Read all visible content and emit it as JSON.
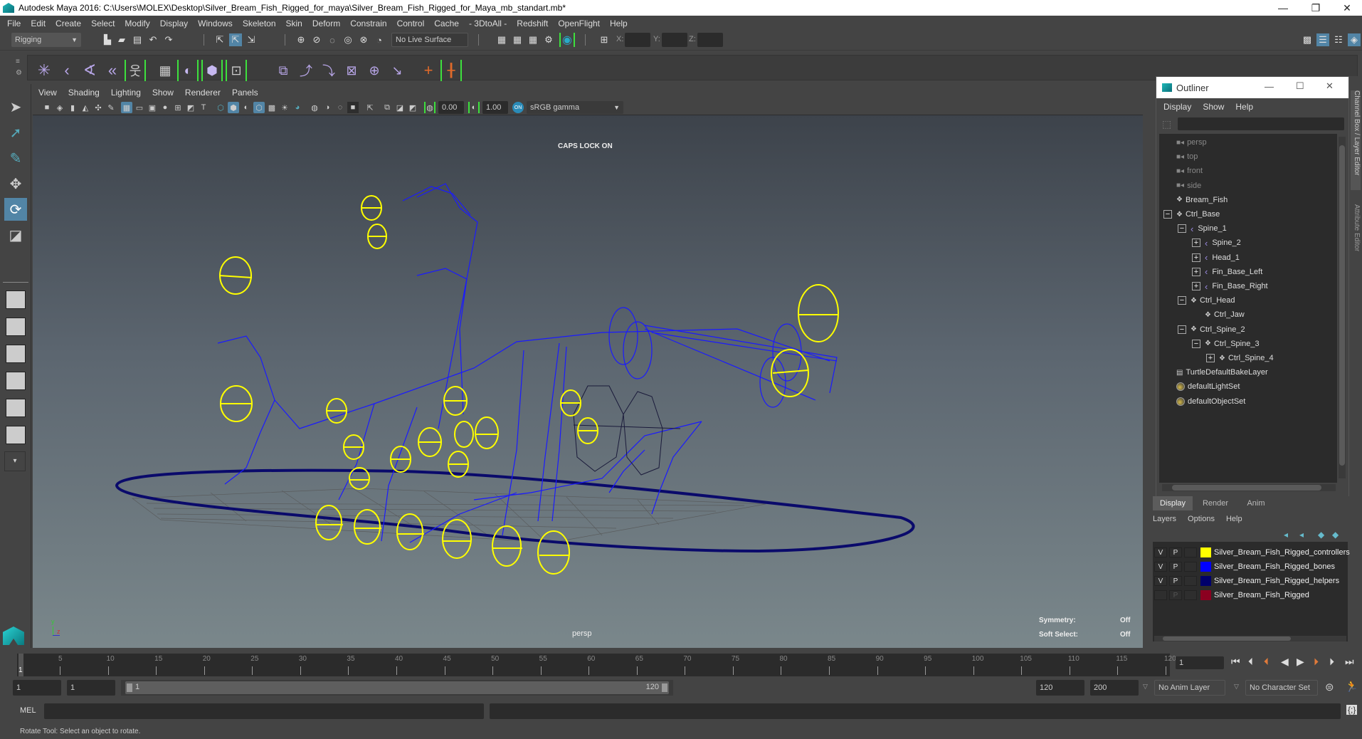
{
  "window": {
    "title": "Autodesk Maya 2016: C:\\Users\\MOLEX\\Desktop\\Silver_Bream_Fish_Rigged_for_maya\\Silver_Bream_Fish_Rigged_for_Maya_mb_standart.mb*",
    "minimize": "—",
    "restore": "❐",
    "close": "✕"
  },
  "menubar": [
    "File",
    "Edit",
    "Create",
    "Select",
    "Modify",
    "Display",
    "Windows",
    "Skeleton",
    "Skin",
    "Deform",
    "Constrain",
    "Control",
    "Cache",
    "- 3DtoAll -",
    "Redshift",
    "OpenFlight",
    "Help"
  ],
  "statusline": {
    "menuset": "Rigging",
    "live_surface": "No Live Surface",
    "x_label": "X:",
    "y_label": "Y:",
    "z_label": "Z:"
  },
  "viewport": {
    "menu": [
      "View",
      "Shading",
      "Lighting",
      "Show",
      "Renderer",
      "Panels"
    ],
    "exposure": "0.00",
    "gamma": "1.00",
    "color_space": "sRGB gamma",
    "caps_lock": "CAPS LOCK ON",
    "camera": "persp",
    "symmetry_label": "Symmetry:",
    "symmetry_value": "Off",
    "soft_select_label": "Soft Select:",
    "soft_select_value": "Off",
    "axis_y": "y",
    "axis_z": "z"
  },
  "outliner": {
    "title": "Outliner",
    "menu": [
      "Display",
      "Show",
      "Help"
    ],
    "items": [
      {
        "label": "persp",
        "type": "camera",
        "depth": 0,
        "expand": "",
        "dim": true
      },
      {
        "label": "top",
        "type": "camera",
        "depth": 0,
        "expand": "",
        "dim": true
      },
      {
        "label": "front",
        "type": "camera",
        "depth": 0,
        "expand": "",
        "dim": true
      },
      {
        "label": "side",
        "type": "camera",
        "depth": 0,
        "expand": "",
        "dim": true
      },
      {
        "label": "Bream_Fish",
        "type": "ctrl",
        "depth": 0,
        "expand": ""
      },
      {
        "label": "Ctrl_Base",
        "type": "ctrl",
        "depth": 0,
        "expand": "−"
      },
      {
        "label": "Spine_1",
        "type": "joint",
        "depth": 1,
        "expand": "−"
      },
      {
        "label": "Spine_2",
        "type": "joint",
        "depth": 2,
        "expand": "+"
      },
      {
        "label": "Head_1",
        "type": "joint",
        "depth": 2,
        "expand": "+"
      },
      {
        "label": "Fin_Base_Left",
        "type": "joint",
        "depth": 2,
        "expand": "+"
      },
      {
        "label": "Fin_Base_Right",
        "type": "joint",
        "depth": 2,
        "expand": "+"
      },
      {
        "label": "Ctrl_Head",
        "type": "ctrl",
        "depth": 1,
        "expand": "−"
      },
      {
        "label": "Ctrl_Jaw",
        "type": "ctrl",
        "depth": 2,
        "expand": ""
      },
      {
        "label": "Ctrl_Spine_2",
        "type": "ctrl",
        "depth": 1,
        "expand": "−"
      },
      {
        "label": "Ctrl_Spine_3",
        "type": "ctrl",
        "depth": 2,
        "expand": "−"
      },
      {
        "label": "Ctrl_Spine_4",
        "type": "ctrl",
        "depth": 3,
        "expand": "+"
      },
      {
        "label": "TurtleDefaultBakeLayer",
        "type": "layer",
        "depth": 0,
        "expand": ""
      },
      {
        "label": "defaultLightSet",
        "type": "set",
        "depth": 0,
        "expand": ""
      },
      {
        "label": "defaultObjectSet",
        "type": "set",
        "depth": 0,
        "expand": ""
      }
    ]
  },
  "right_tabs": [
    "Channel Box / Layer Editor",
    "Attribute Editor"
  ],
  "layer_editor": {
    "tabs": [
      "Display",
      "Render",
      "Anim"
    ],
    "active_tab": "Display",
    "menu": [
      "Layers",
      "Options",
      "Help"
    ],
    "layers": [
      {
        "v": "V",
        "p": "P",
        "name": "Silver_Bream_Fish_Rigged_controllers",
        "color": "#ffff00"
      },
      {
        "v": "V",
        "p": "P",
        "name": "Silver_Bream_Fish_Rigged_bones",
        "color": "#0000ff"
      },
      {
        "v": "V",
        "p": "P",
        "name": "Silver_Bream_Fish_Rigged_helpers",
        "color": "#00006b"
      },
      {
        "v": "",
        "p": "P",
        "name": "Silver_Bream_Fish_Rigged",
        "color": "#8b0020"
      }
    ]
  },
  "timeline": {
    "ticks": [
      5,
      10,
      15,
      20,
      25,
      30,
      35,
      40,
      45,
      50,
      55,
      60,
      65,
      70,
      75,
      80,
      85,
      90,
      95,
      100,
      105,
      110,
      115,
      120
    ],
    "current_frame_marker": "1",
    "current_frame": "1"
  },
  "range": {
    "start": "1",
    "playback_start": "1",
    "slider_start": "1",
    "slider_end": "120",
    "playback_end": "120",
    "end": "200",
    "anim_layer": "No Anim Layer",
    "character_set": "No Character Set"
  },
  "mel": {
    "label": "MEL"
  },
  "helpline": "Rotate Tool: Select an object to rotate.",
  "colors": {
    "controllers": "#ffff00",
    "bones": "#1a1aff",
    "helpers": "#00006b",
    "active_tool": "#5285a6",
    "bracket": "#3de03d"
  }
}
